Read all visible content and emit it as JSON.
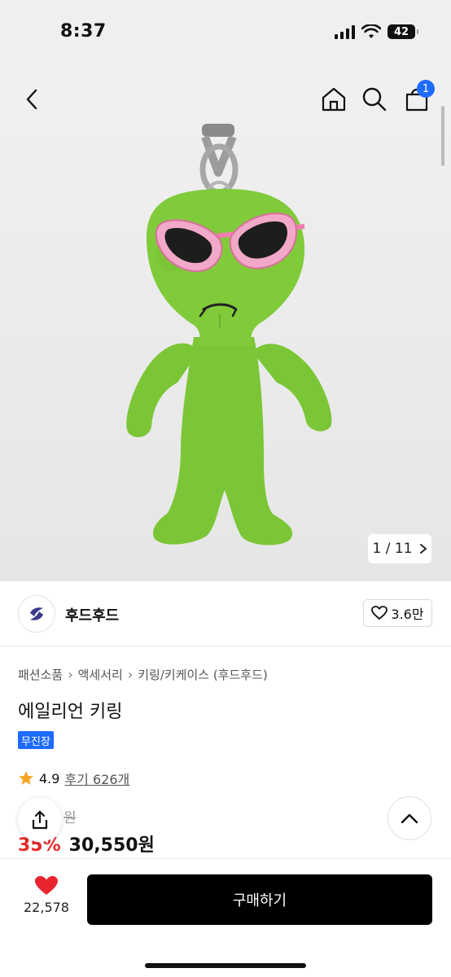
{
  "status": {
    "time": "8:37",
    "battery": "42"
  },
  "nav": {
    "cart_count": "1"
  },
  "gallery": {
    "current": "1",
    "total": "11",
    "separator": "/"
  },
  "brand": {
    "name": "후드후드",
    "likes": "3.6만"
  },
  "breadcrumb": [
    "패션소품",
    "액세서리",
    "키링/키케이스 (후드후드)"
  ],
  "product": {
    "title": "에일리언 키링",
    "badge": "무진장",
    "rating": "4.9",
    "reviews": "후기 626개",
    "original_price": "원",
    "discount": "35%",
    "price": "30,550원"
  },
  "bottom": {
    "like_count": "22,578",
    "buy_label": "구매하기"
  },
  "colors": {
    "accent": "#1e6bff",
    "discount": "#e82a2a",
    "alien_green": "#7fc93a",
    "glasses_pink": "#f2a8c8"
  },
  "icons": [
    "back-icon",
    "home-icon",
    "search-icon",
    "cart-icon",
    "chevron-right-icon",
    "heart-outline-icon",
    "star-icon",
    "share-icon",
    "chevron-up-icon",
    "heart-filled-icon"
  ]
}
